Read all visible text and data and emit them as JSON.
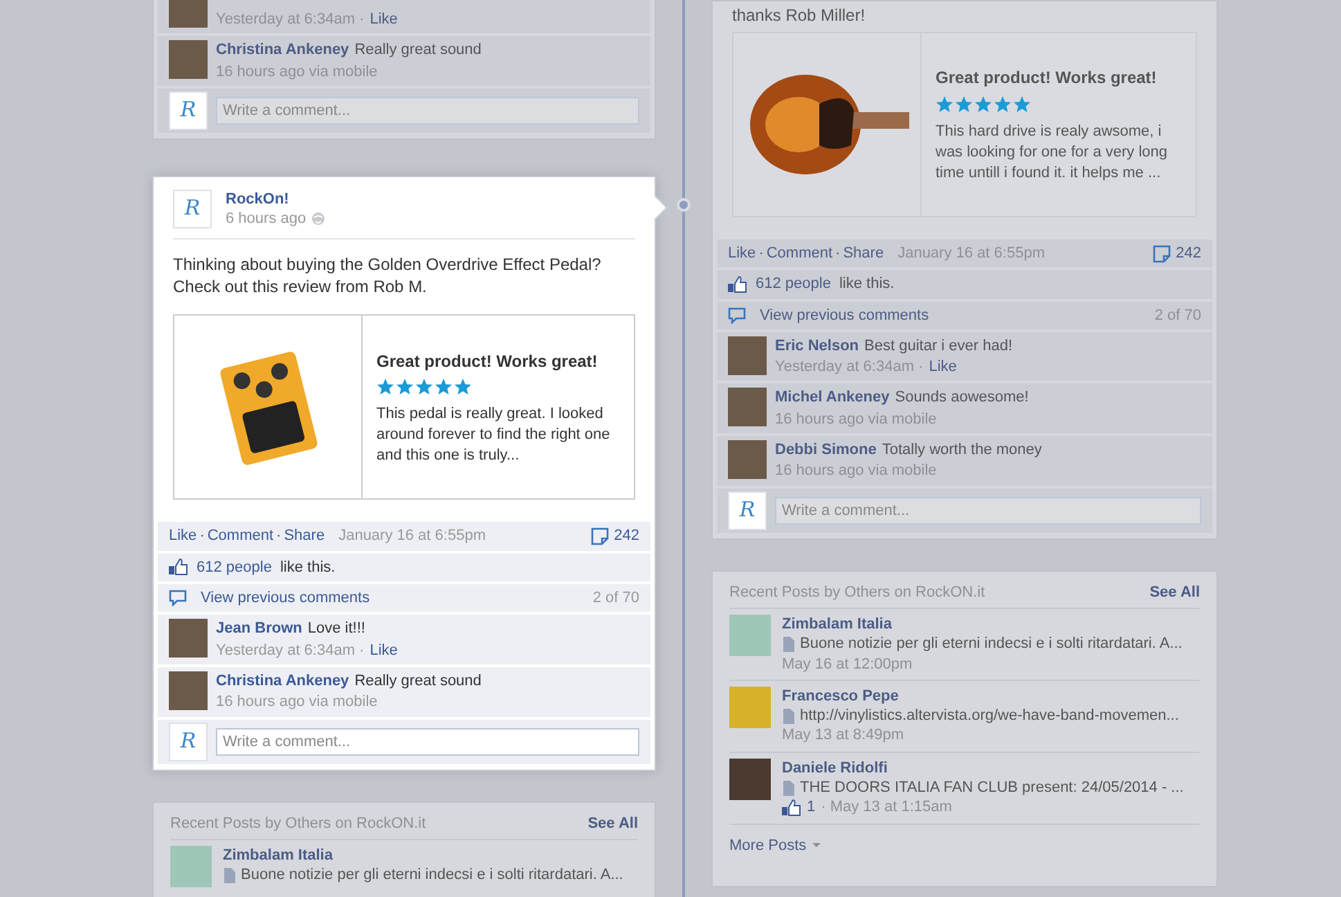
{
  "timeline": {
    "left": [
      {
        "kind": "post",
        "focused": false,
        "comments": [
          {
            "meta": "Yesterday at 6:34am ·",
            "like": "Like"
          },
          {
            "name": "Christina Ankeney",
            "text": "Really great sound",
            "meta": "16 hours ago via mobile"
          }
        ],
        "composer": {
          "logo": "R",
          "placeholder": "Write a comment..."
        }
      },
      {
        "kind": "post",
        "focused": true,
        "author": {
          "logo": "R",
          "name": "RockOn!",
          "time": "6 hours ago"
        },
        "message": "Thinking about buying the Golden Overdrive Effect Pedal? Check out this review from Rob M.",
        "review": {
          "title": "Great product! Works great!",
          "stars": 5,
          "text": "This pedal is really great. I looked around forever to find the right one and this one is truly..."
        },
        "actions": [
          "Like",
          "Comment",
          "Share"
        ],
        "separator": "·",
        "date": "January 16 at 6:55pm",
        "comment_count": "242",
        "likes": {
          "count": "612 people",
          "text": "like this."
        },
        "previous": {
          "label": "View previous comments",
          "count": "2 of 70"
        },
        "comments": [
          {
            "name": "Jean Brown",
            "text": "Love it!!!",
            "meta": "Yesterday at 6:34am ·",
            "like": "Like"
          },
          {
            "name": "Christina Ankeney",
            "text": "Really great sound",
            "meta": "16 hours ago via mobile"
          }
        ],
        "composer": {
          "logo": "R",
          "placeholder": "Write a comment..."
        }
      },
      {
        "kind": "recent",
        "focused": false,
        "title": "Recent Posts by Others on RockON.it",
        "see_all": "See All",
        "posts": [
          {
            "name": "Zimbalam Italia",
            "text": "Buone notizie per gli eterni indecsi e i solti ritardatari. A..."
          }
        ]
      }
    ],
    "right": [
      {
        "kind": "post",
        "focused": false,
        "message": "thanks Rob Miller!",
        "review": {
          "title": "Great product! Works great!",
          "stars": 5,
          "text": "This hard drive is realy awsome, i was looking for one for a very long time untill i found it. it helps me ..."
        },
        "actions": [
          "Like",
          "Comment",
          "Share"
        ],
        "separator": "·",
        "date": "January 16 at 6:55pm",
        "comment_count": "242",
        "likes": {
          "count": "612 people",
          "text": "like this."
        },
        "previous": {
          "label": "View previous comments",
          "count": "2 of 70"
        },
        "comments": [
          {
            "name": "Eric Nelson",
            "text": "Best guitar i ever had!",
            "meta": "Yesterday at 6:34am ·",
            "like": "Like"
          },
          {
            "name": "Michel Ankeney",
            "text": "Sounds aowesome!",
            "meta": "16 hours ago via mobile"
          },
          {
            "name": "Debbi Simone",
            "text": "Totally worth the money",
            "meta": "16 hours ago via mobile"
          }
        ],
        "composer": {
          "logo": "R",
          "placeholder": "Write a comment..."
        }
      },
      {
        "kind": "recent",
        "focused": false,
        "title": "Recent Posts by Others on RockON.it",
        "see_all": "See All",
        "posts": [
          {
            "name": "Zimbalam Italia",
            "text": "Buone notizie per gli eterni indecsi e i solti ritardatari. A...",
            "date": "May 16 at 12:00pm"
          },
          {
            "name": "Francesco Pepe",
            "text": "http://vinylistics.altervista.org/we-have-band-movemen...",
            "date": "May 13 at 8:49pm"
          },
          {
            "name": "Daniele Ridolfi",
            "text": "THE DOORS ITALIA FAN CLUB present: 24/05/2014 - ...",
            "likes": "1",
            "date": "· May 13 at 1:15am"
          }
        ],
        "more": "More Posts"
      }
    ]
  }
}
